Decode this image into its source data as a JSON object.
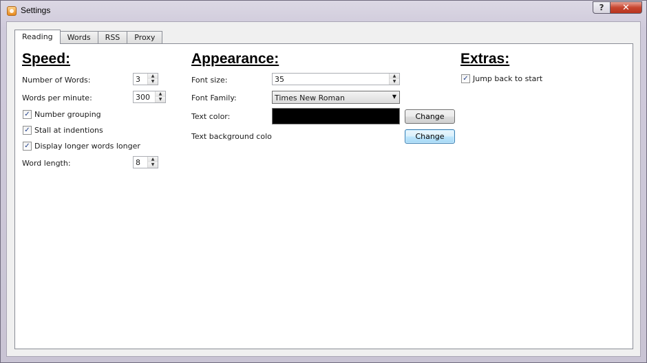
{
  "window": {
    "title": "Settings"
  },
  "caption": {
    "help": "?",
    "close": "✕"
  },
  "tabs": [
    "Reading",
    "Words",
    "RSS",
    "Proxy"
  ],
  "speed": {
    "heading": "Speed:",
    "number_of_words_label": "Number of Words:",
    "number_of_words_value": "3",
    "words_per_minute_label": "Words per minute:",
    "words_per_minute_value": "300",
    "number_grouping_label": "Number grouping",
    "stall_label": "Stall at indentions",
    "display_longer_label": "Display longer words longer",
    "word_length_label": "Word length:",
    "word_length_value": "8",
    "number_grouping_checked": true,
    "stall_checked": true,
    "display_longer_checked": true
  },
  "appearance": {
    "heading": "Appearance:",
    "font_size_label": "Font size:",
    "font_size_value": "35",
    "font_family_label": "Font Family:",
    "font_family_value": "Times New Roman",
    "text_color_label": "Text color:",
    "text_color": "#000000",
    "text_bg_label": "Text background color:",
    "text_bg_color": "#ffffff",
    "change_label": "Change",
    "change_bg_label": "Change"
  },
  "extras": {
    "heading": "Extras:",
    "jump_back_label": "Jump back to start",
    "jump_back_checked": true
  },
  "glyphs": {
    "check": "✓",
    "up": "▲",
    "down": "▼",
    "drop": "▼"
  }
}
